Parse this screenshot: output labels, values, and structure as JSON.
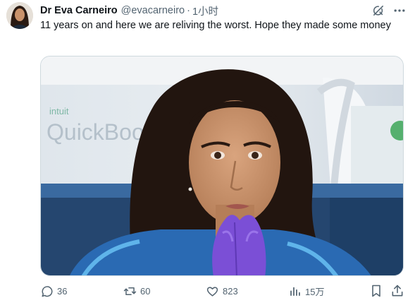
{
  "author": {
    "name": "Dr Eva Carneiro",
    "handle": "@evacarneiro",
    "separator": "·",
    "time": "1小时"
  },
  "tweet": {
    "text": "11 years on and here we are reliving the worst. Hope they made some money"
  },
  "media": {
    "sign_small": "intuit",
    "sign_large": "QuickBook"
  },
  "actions": {
    "replies": "36",
    "reposts": "60",
    "likes": "823",
    "views": "15万"
  },
  "icons": {
    "grok": "grok-icon",
    "more": "more-icon",
    "reply": "reply-icon",
    "repost": "repost-icon",
    "like": "like-icon",
    "views": "views-icon",
    "bookmark": "bookmark-icon",
    "share": "share-icon"
  },
  "colors": {
    "text": "#0f1419",
    "secondary": "#536471",
    "glove": "#7b4fd6"
  }
}
